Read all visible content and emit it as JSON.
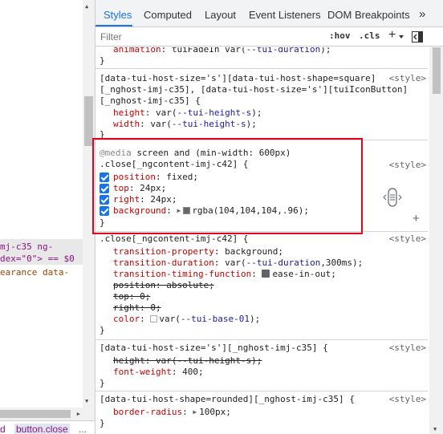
{
  "tabs": [
    "Styles",
    "Computed",
    "Layout",
    "Event Listeners",
    "DOM Breakpoints"
  ],
  "tabs_more": "»",
  "filter": {
    "placeholder": "Filter",
    "hov": ":hov",
    "cls": ".cls",
    "plus": "+"
  },
  "left_panel": {
    "lines": [
      "mj-c35 ng-",
      "dex=\"0\"> == $0",
      "earance data-"
    ],
    "breadcrumbs": [
      "d",
      "button.close",
      "..."
    ]
  },
  "rules": {
    "r0": {
      "animation_prop": "animation",
      "animation_val_pre": "tuiFadeIn var(",
      "animation_var": "--tui-duration",
      "animation_val_post": ");",
      "close": "}"
    },
    "r1": {
      "selector": [
        "[data-tui-host-size='s'][data-tui-host-shape=square]",
        "[_nghost-imj-c35], [data-tui-host-size='s'][tuiIconButton]",
        "[_nghost-imj-c35] {"
      ],
      "origin": "<style>",
      "height_prop": "height",
      "height_pre": "var(",
      "height_var": "--tui-height-s",
      "height_post": ");",
      "width_prop": "width",
      "width_pre": "var(",
      "width_var": "--tui-height-s",
      "width_post": ");",
      "close": "}"
    },
    "r2": {
      "media_kw": "@media",
      "media_rest": " screen and (min-width: 600px)",
      "selector": ".close[_ngcontent-imj-c42] {",
      "origin": "<style>",
      "props": [
        {
          "p": "position",
          "v": "fixed;"
        },
        {
          "p": "top",
          "v": "24px;"
        },
        {
          "p": "right",
          "v": "24px;"
        },
        {
          "p": "background",
          "v": "rgba(104,104,104,.96);"
        }
      ],
      "bg_swatch": "#686868",
      "close": "}"
    },
    "r3": {
      "selector": ".close[_ngcontent-imj-c42] {",
      "origin": "<style>",
      "tp_prop": "transition-property",
      "tp_val": "background;",
      "td_prop": "transition-duration",
      "td_pre": "var(",
      "td_var": "--tui-duration",
      "td_post": ",300ms);",
      "ttf_prop": "transition-timing-function",
      "ttf_val": "ease-in-out;",
      "pos_text": "position: absolute;",
      "top_text": "top: 0;",
      "right_text": "right: 0;",
      "color_prop": "color",
      "color_pre": "var(",
      "color_var": "--tui-base-01",
      "color_post": ");",
      "close": "}"
    },
    "r4": {
      "selector": "[data-tui-host-size='s'][_nghost-imj-c35] {",
      "origin": "<style>",
      "height_text": "height: var(--tui-height-s);",
      "fw_prop": "font-weight",
      "fw_val": "400;",
      "close": "}"
    },
    "r5": {
      "selector": "[data-tui-host-shape=rounded][_nghost-imj-c35] {",
      "origin": "<style>",
      "br_prop": "border-radius",
      "br_val": "100px;",
      "close": "}"
    }
  },
  "colors": {
    "accent": "#1a73e8",
    "highlight_box": "#e6001e",
    "prop": "#c80000",
    "var": "#1a1aa6"
  }
}
